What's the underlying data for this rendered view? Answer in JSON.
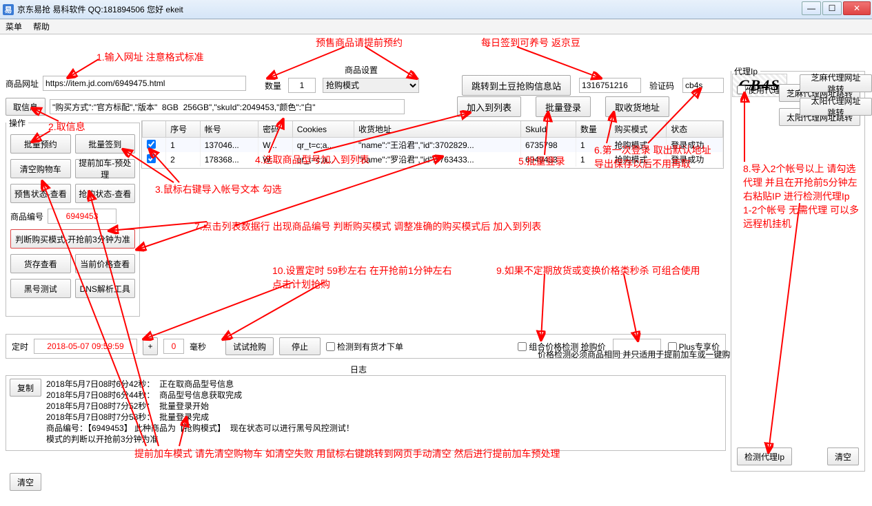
{
  "window": {
    "title": "京东易抢   易科软件 QQ:181894506    您好 ekeit"
  },
  "menu": {
    "m1": "菜单",
    "m2": "帮助"
  },
  "url": {
    "label": "商品网址",
    "value": "https://item.jd.com/6949475.html"
  },
  "goods": {
    "group_title": "商品设置",
    "qty_label": "数量",
    "qty_value": "1",
    "mode_label": "抢购模式"
  },
  "topbtns": {
    "jump": "跳转到土豆抢购信息站",
    "num_value": "1316751216",
    "captcha_label": "验证码",
    "captcha_value": "cb4s",
    "captcha_img": "CB4S"
  },
  "row2": {
    "getinfo": "取信息",
    "cond_value": "\"购买方式\":\"官方标配\",\"版本\"  8GB  256GB\",\"skuId\":2049453,\"颜色\":\"白\"",
    "addlist": "加入到列表",
    "batch_login": "批量登录",
    "get_addr": "取收货地址"
  },
  "ops": {
    "legend": "操作",
    "b1": "批量预约",
    "b2": "批量签到",
    "b3": "清空购物车",
    "b4": "提前加车-预处理",
    "b5": "预售状态-查看",
    "b6": "抢购状态-查看",
    "id_label": "商品编号",
    "id_value": "6949453",
    "b7": "判断购买模式-开抢前3分钟为准",
    "b8": "货存查看",
    "b9": "当前价格查看",
    "b10": "黑号测试",
    "b11": "DNS解析工具"
  },
  "tbl": {
    "cols": [
      "",
      "序号",
      "帐号",
      "密码",
      "Cookies",
      "收货地址",
      "SkuId",
      "数量",
      "购买模式",
      "状态"
    ],
    "rows": [
      {
        "chk": true,
        "idx": "1",
        "acc": "137046...",
        "pwd": "W...",
        "ck": "qr_t=c;a...",
        "addr": "\"name\":\"王沿君\",\"id\":3702829...",
        "sku": "6735798",
        "qty": "1",
        "mode": "抢购模式",
        "stat": "登录成功"
      },
      {
        "chk": true,
        "idx": "2",
        "acc": "178368...",
        "pwd": "W...",
        "ck": "qr_t=c;a...",
        "addr": "\"name\":\"罗沿君\",\"id\":5763433...",
        "sku": "6949453",
        "qty": "1",
        "mode": "抢购模式",
        "stat": "登录成功"
      }
    ]
  },
  "proxy": {
    "legend": "代理Ip",
    "use": "使用代理",
    "b1": "芝麻代理网址跳转",
    "b2": "太阳代理网址跳转",
    "check": "检测代理Ip",
    "clear": "清空"
  },
  "timer": {
    "label": "定时",
    "value": "2018-05-07 09:59:59",
    "plus": "+",
    "ms_value": "0",
    "ms_label": "毫秒",
    "try": "试试抢购",
    "stop": "停止",
    "check_stock": "检测到有货才下单",
    "combo": "组合价格检测  抢购价",
    "plus_only": "Plus专享价",
    "note": "价格检测必须商品相同 并只适用于提前加车或一键购"
  },
  "log": {
    "title": "日志",
    "copy": "复制",
    "clear": "清空",
    "lines": "2018年5月7日08时6分42秒：  正在取商品型号信息\n2018年5月7日08时6分44秒：  商品型号信息获取完成\n2018年5月7日08时7分52秒：  批量登录开始\n2018年5月7日08时7分58秒：  批量登录完成\n商品编号：【6949453】 此种商品为【抢购模式】  现在状态可以进行黑号风控测试！\n模式的判断以开抢前3分钟为准"
  },
  "anno": {
    "a_pre": "预售商品请提前预约",
    "a_daily": "每日签到可养号 返京豆",
    "a1": "1.输入网址 注意格式标准",
    "a2": "2.取信息",
    "a3": "3.鼠标右键导入帐号文本 勾选",
    "a4": "4.选取商品型号加入到列表",
    "a5": "5.批量登录",
    "a6": "6.第一次登录 取出默认地址\n导出保存以后不用再取",
    "a7": "7.点击列表数据行 出现商品编号 判断购买模式 调整准确的购买模式后 加入到列表",
    "a8": "8.导入2个帐号以上 请勾选代理 并且在开抢前5分钟左右粘贴IP 进行检测代理Ip 1-2个帐号 无需代理 可以多远程机挂机",
    "a9": "9.如果不定期放货或变换价格类秒杀 可组合使用",
    "a10": "10.设置定时 59秒左右 在开抢前1分钟左右\n点击计划抢购",
    "a_bottom": "提前加车模式 请先清空购物车 如清空失败 用鼠标右键跳转到网页手动清空 然后进行提前加车预处理"
  }
}
